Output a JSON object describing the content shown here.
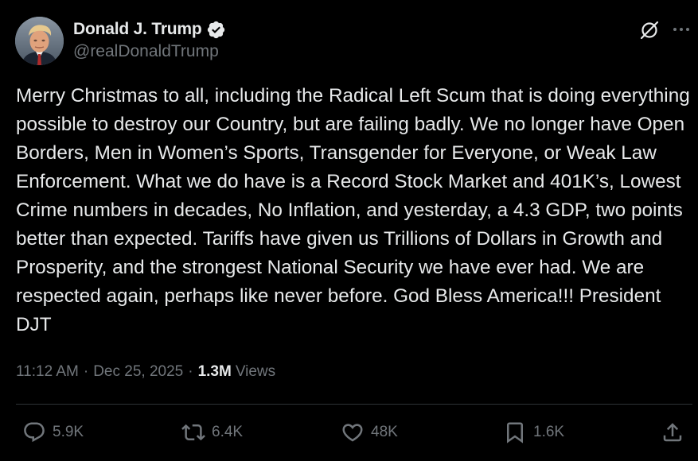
{
  "author": {
    "display_name": "Donald J. Trump",
    "handle": "@realDonaldTrump",
    "verified_icon": "verified-badge-icon",
    "verified_color": "#1d9bf0"
  },
  "tweet": {
    "text": "Merry Christmas to all, including the Radical Left Scum that is doing everything possible to destroy our Country, but are failing badly. We no longer have Open Borders, Men in Women’s Sports, Transgender for Everyone, or Weak Law Enforcement. What we do have is a Record Stock Market and 401K’s, Lowest Crime numbers in decades, No Inflation, and yesterday, a 4.3 GDP, two points better than expected. Tariffs have given us Trillions of Dollars in Growth and Prosperity, and the strongest National Security we have ever had. We are respected again, perhaps like never before. God Bless America!!! President DJT",
    "time": "11:12 AM",
    "separator": "·",
    "date": "Dec 25, 2025",
    "views_count": "1.3M",
    "views_label": "Views"
  },
  "header_icons": {
    "grok": "grok-icon",
    "more": "more-options-icon"
  },
  "actions": {
    "reply": {
      "icon": "reply-icon",
      "count": "5.9K"
    },
    "repost": {
      "icon": "repost-icon",
      "count": "6.4K"
    },
    "like": {
      "icon": "like-heart-icon",
      "count": "48K"
    },
    "bookmark": {
      "icon": "bookmark-icon",
      "count": "1.6K"
    },
    "share": {
      "icon": "share-icon"
    }
  },
  "colors": {
    "background": "#000000",
    "text_primary": "#e7e9ea",
    "text_secondary": "#71767b",
    "divider": "#2f3336"
  }
}
